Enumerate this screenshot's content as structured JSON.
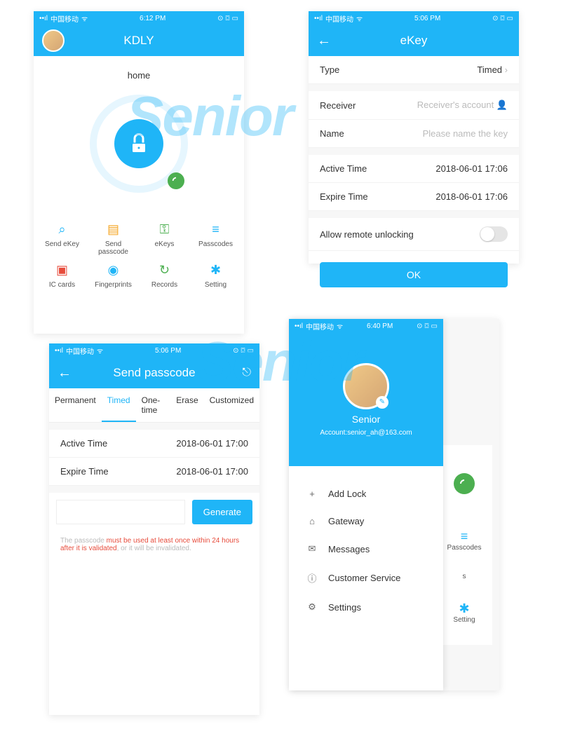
{
  "statusbar": {
    "carrier": "中国移动",
    "wifi": "●",
    "bt": "*"
  },
  "p1": {
    "time": "6:12 PM",
    "title": "KDLY",
    "home": "home",
    "grid": [
      {
        "label": "Send eKey",
        "color": "#1fb5f7",
        "icon": "⌕"
      },
      {
        "label": "Send passcode",
        "color": "#f5a623",
        "icon": "▤"
      },
      {
        "label": "eKeys",
        "color": "#4caf50",
        "icon": "⚿"
      },
      {
        "label": "Passcodes",
        "color": "#1fb5f7",
        "icon": "≡"
      },
      {
        "label": "IC cards",
        "color": "#e74c3c",
        "icon": "▣"
      },
      {
        "label": "Fingerprints",
        "color": "#1fb5f7",
        "icon": "◉"
      },
      {
        "label": "Records",
        "color": "#4caf50",
        "icon": "↻"
      },
      {
        "label": "Setting",
        "color": "#1fb5f7",
        "icon": "✱"
      }
    ]
  },
  "p2": {
    "time": "5:06 PM",
    "title": "eKey",
    "type_label": "Type",
    "type_val": "Timed",
    "receiver_label": "Receiver",
    "receiver_ph": "Receiver's account",
    "name_label": "Name",
    "name_ph": "Please name the key",
    "active_label": "Active Time",
    "active_val": "2018-06-01 17:06",
    "expire_label": "Expire Time",
    "expire_val": "2018-06-01 17:06",
    "remote_label": "Allow remote unlocking",
    "ok": "OK"
  },
  "p3": {
    "time": "5:06 PM",
    "title": "Send passcode",
    "tabs": [
      "Permanent",
      "Timed",
      "One-time",
      "Erase",
      "Customized"
    ],
    "active_tab": 1,
    "active_label": "Active Time",
    "active_val": "2018-06-01 17:00",
    "expire_label": "Expire Time",
    "expire_val": "2018-06-01 17:00",
    "generate": "Generate",
    "note_pre": "The passcode ",
    "note_red": "must be used at least once within 24 hours after it is validated",
    "note_post": ", or it will be invalidated."
  },
  "p4": {
    "time": "6:40 PM",
    "name": "Senior",
    "account_label": "Account:",
    "account": "senior_ah@163.com",
    "items": [
      {
        "icon": "+",
        "label": "Add Lock"
      },
      {
        "icon": "⌂",
        "label": "Gateway"
      },
      {
        "icon": "✉",
        "label": "Messages"
      },
      {
        "icon": "ⓘ",
        "label": "Customer Service"
      },
      {
        "icon": "⚙",
        "label": "Settings"
      }
    ],
    "bg_passcodes": "Passcodes",
    "bg_setting": "Setting",
    "bg_s": "s"
  },
  "watermark": "Senior"
}
